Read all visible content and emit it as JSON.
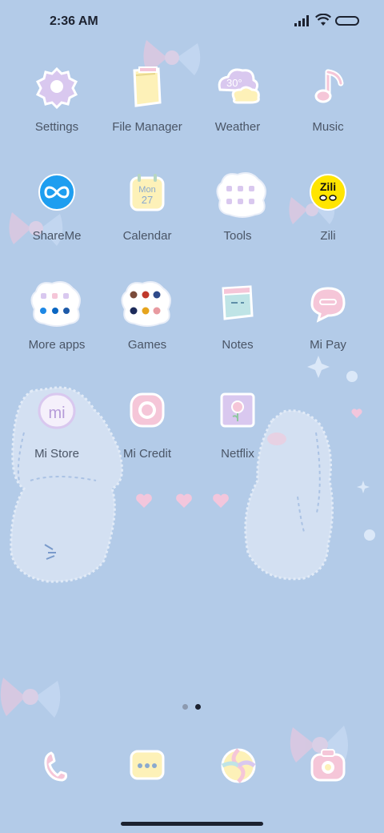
{
  "status_bar": {
    "time": "2:36 AM"
  },
  "apps": [
    {
      "label": "Settings",
      "icon": "gear-icon"
    },
    {
      "label": "File Manager",
      "icon": "folder-icon"
    },
    {
      "label": "Weather",
      "icon": "cloud-sun-icon",
      "icon_text": "30°"
    },
    {
      "label": "Music",
      "icon": "music-note-icon"
    },
    {
      "label": "ShareMe",
      "icon": "infinity-icon"
    },
    {
      "label": "Calendar",
      "icon": "calendar-icon",
      "icon_day": "Mon",
      "icon_date": "27"
    },
    {
      "label": "Tools",
      "icon": "folder-grid-icon"
    },
    {
      "label": "Zili",
      "icon": "zili-icon",
      "icon_text": "Zili"
    },
    {
      "label": "More apps",
      "icon": "folder-grid-icon"
    },
    {
      "label": "Games",
      "icon": "folder-grid-icon"
    },
    {
      "label": "Notes",
      "icon": "notes-icon"
    },
    {
      "label": "Mi Pay",
      "icon": "chat-bubble-icon"
    },
    {
      "label": "Mi Store",
      "icon": "mi-store-icon",
      "icon_text": "mi"
    },
    {
      "label": "Mi Credit",
      "icon": "ring-icon"
    },
    {
      "label": "Netflix",
      "icon": "flower-card-icon"
    }
  ],
  "page_indicator": {
    "current": 2,
    "total": 2
  },
  "dock": [
    {
      "name": "phone",
      "icon": "phone-icon"
    },
    {
      "name": "messages",
      "icon": "message-icon"
    },
    {
      "name": "browser",
      "icon": "ball-icon"
    },
    {
      "name": "camera",
      "icon": "camera-icon"
    }
  ],
  "colors": {
    "background": "#b3cbe8",
    "icon_outline": "#ffffff",
    "icon_pink": "#f5c6d8",
    "icon_lilac": "#d9c8ef",
    "icon_yellow": "#fdf1b8",
    "shareme_blue": "#1e9ef0",
    "zili_yellow": "#ffe500"
  }
}
